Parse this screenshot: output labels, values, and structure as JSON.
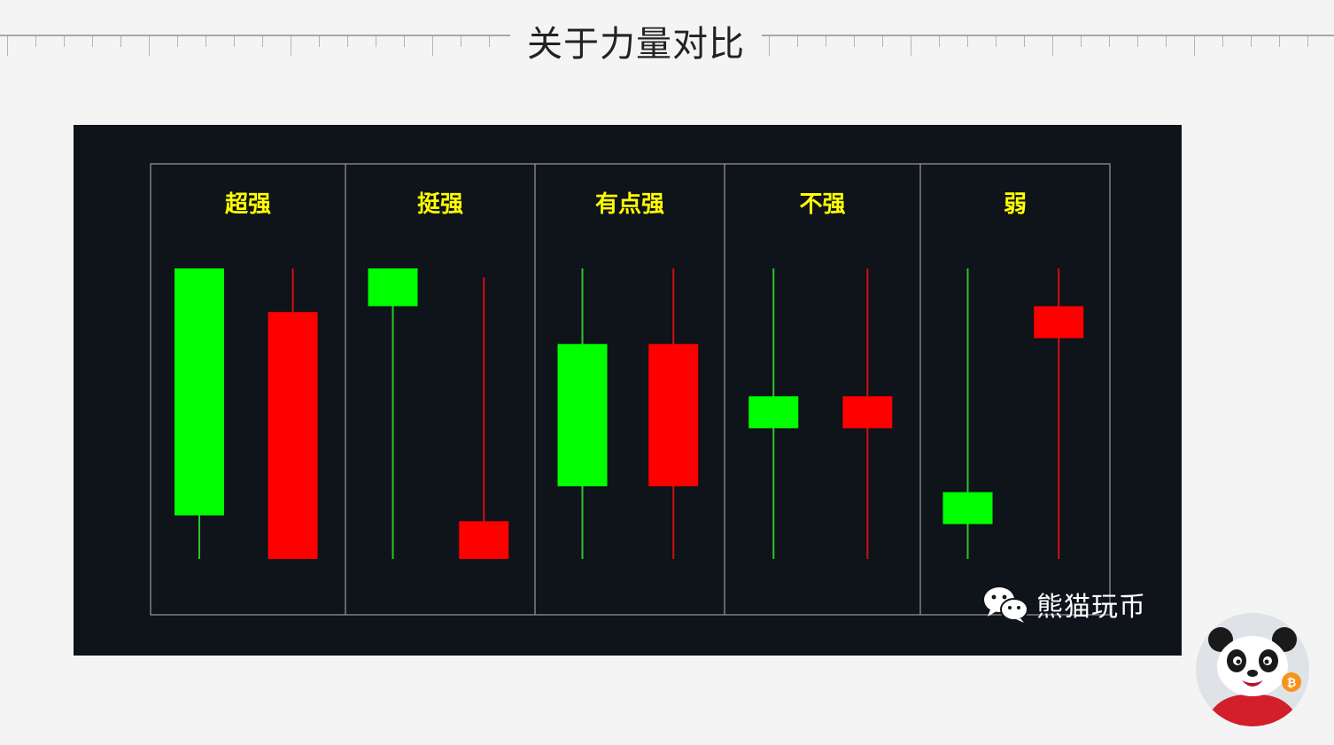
{
  "page": {
    "title": "关于力量对比",
    "watermark": "熊猫玩币"
  },
  "colors": {
    "bull": "#00ff00",
    "bear": "#ff0000",
    "panel_label": "#ffff00",
    "background": "#0f131a",
    "grid": "#9a9a9a"
  },
  "icons": [
    "wechat-icon",
    "panda-avatar-icon",
    "bitcoin-badge-icon"
  ],
  "chart_data": {
    "type": "candlestick",
    "title": "",
    "xlabel": "",
    "ylabel": "",
    "ylim": [
      0,
      100
    ],
    "grid": true,
    "panels": [
      {
        "label": "超强",
        "candles": [
          {
            "color": "green",
            "open": 15,
            "close": 100,
            "high": 100,
            "low": 0
          },
          {
            "color": "red",
            "open": 85,
            "close": 0,
            "high": 100,
            "low": 0
          }
        ]
      },
      {
        "label": "挺强",
        "candles": [
          {
            "color": "green",
            "open": 87,
            "close": 100,
            "high": 100,
            "low": 0
          },
          {
            "color": "red",
            "open": 13,
            "close": 0,
            "high": 97,
            "low": 0
          }
        ]
      },
      {
        "label": "有点强",
        "candles": [
          {
            "color": "green",
            "open": 25,
            "close": 74,
            "high": 100,
            "low": 0
          },
          {
            "color": "red",
            "open": 74,
            "close": 25,
            "high": 100,
            "low": 0
          }
        ]
      },
      {
        "label": "不强",
        "candles": [
          {
            "color": "green",
            "open": 45,
            "close": 56,
            "high": 100,
            "low": 0
          },
          {
            "color": "red",
            "open": 56,
            "close": 45,
            "high": 100,
            "low": 0
          }
        ]
      },
      {
        "label": "弱",
        "candles": [
          {
            "color": "green",
            "open": 12,
            "close": 23,
            "high": 100,
            "low": 0
          },
          {
            "color": "red",
            "open": 87,
            "close": 76,
            "high": 100,
            "low": 0
          }
        ]
      }
    ]
  }
}
